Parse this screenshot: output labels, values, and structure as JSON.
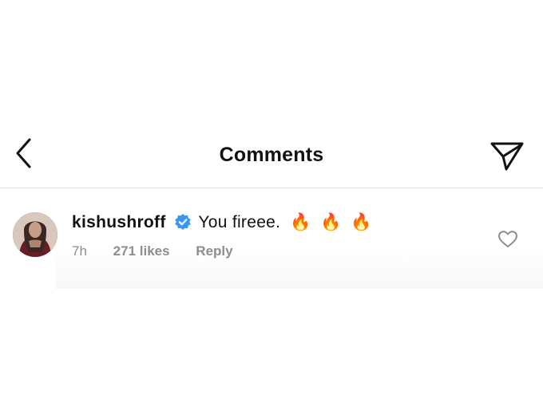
{
  "header": {
    "title": "Comments",
    "back_icon": "chevron-left-icon",
    "share_icon": "paper-plane-icon"
  },
  "comment": {
    "username": "kishushroff",
    "verified": true,
    "text": "You fireee.",
    "emojis": [
      "🔥",
      "🔥",
      "🔥"
    ],
    "time": "7h",
    "likes": "271 likes",
    "reply_label": "Reply",
    "like_icon": "heart-outline-icon"
  },
  "colors": {
    "verified_badge": "#3897f0",
    "meta_text": "#8e8e8e",
    "divider": "#e4e4e4"
  }
}
